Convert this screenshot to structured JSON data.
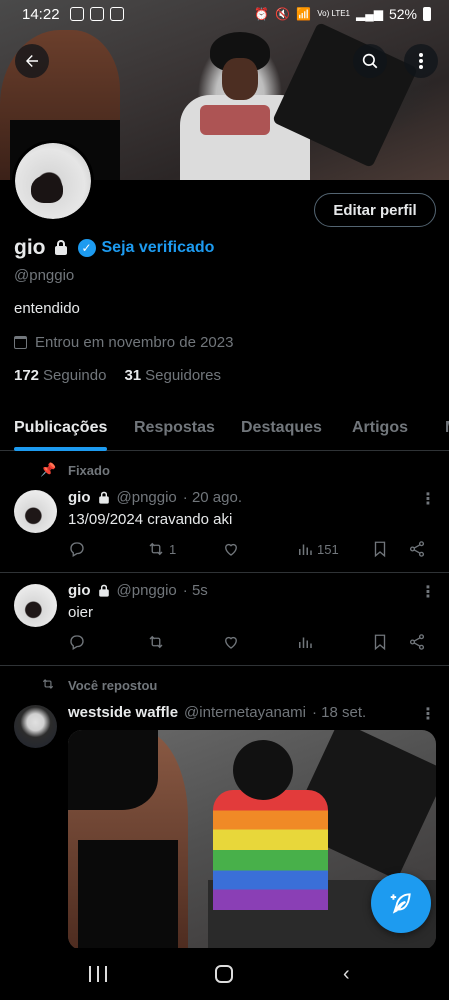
{
  "status_bar": {
    "time": "14:22",
    "network": "Vo) LTE1",
    "battery": "52%"
  },
  "profile": {
    "name": "gio",
    "verify_label": "Seja verificado",
    "handle": "@pnggio",
    "bio": "entendido",
    "joined": "Entrou em novembro de 2023",
    "following_count": "172",
    "following_label": "Seguindo",
    "followers_count": "31",
    "followers_label": "Seguidores",
    "edit_button": "Editar perfil"
  },
  "tabs": [
    {
      "label": "Publicações",
      "active": true
    },
    {
      "label": "Respostas"
    },
    {
      "label": "Destaques"
    },
    {
      "label": "Artigos"
    },
    {
      "label": "M"
    }
  ],
  "posts": [
    {
      "context": "Fixado",
      "author": "gio",
      "handle": "@pnggio",
      "time": "· 20 ago.",
      "text": "13/09/2024 cravando aki",
      "retweets": "1",
      "views": "151"
    },
    {
      "author": "gio",
      "handle": "@pnggio",
      "time": "· 5s",
      "text": "oier"
    },
    {
      "context": "Você repostou",
      "author": "westside waffle",
      "handle": "@internetayanami",
      "time": "· 18 set."
    }
  ],
  "colors": {
    "accent": "#1d9bf0",
    "background": "#000000",
    "muted": "#71767b",
    "divider": "#2f3336"
  }
}
